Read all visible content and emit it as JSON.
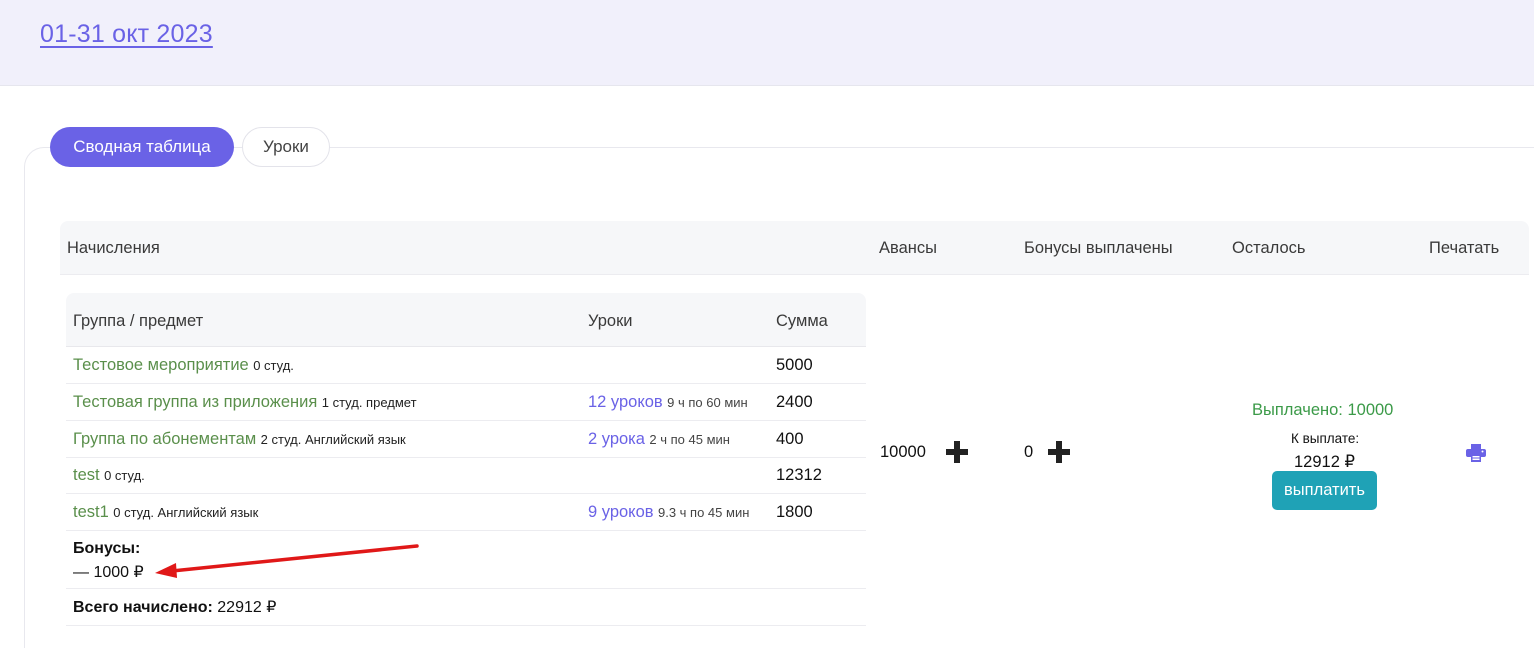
{
  "header": {
    "period": "01-31 окт 2023"
  },
  "tabs": [
    {
      "label": "Сводная таблица",
      "active": true
    },
    {
      "label": "Уроки",
      "active": false
    }
  ],
  "table": {
    "columns": [
      "Начисления",
      "Авансы",
      "Бонусы выплачены",
      "Осталось",
      "Печатать"
    ],
    "accruals": {
      "columns": [
        "Группа / предмет",
        "Уроки",
        "Сумма"
      ],
      "rows": [
        {
          "group": "Тестовое мероприятие",
          "meta": "0 студ.",
          "lessons": "",
          "lessons_meta": "",
          "sum": "5000"
        },
        {
          "group": "Тестовая группа из приложения",
          "meta": "1 студ. предмет",
          "lessons": "12 уроков",
          "lessons_meta": "9 ч по 60 мин",
          "sum": "2400"
        },
        {
          "group": "Группа по абонементам",
          "meta": "2 студ. Английский язык",
          "lessons": "2 урока",
          "lessons_meta": "2 ч по 45 мин",
          "sum": "400"
        },
        {
          "group": "test",
          "meta": "0 студ.",
          "lessons": "",
          "lessons_meta": "",
          "sum": "12312"
        },
        {
          "group": "test1",
          "meta": "0 студ. Английский язык",
          "lessons": "9 уроков",
          "lessons_meta": "9.3 ч по 45 мин",
          "sum": "1800"
        }
      ],
      "bonus_label": "Бонусы:",
      "bonus_value": "— 1000 ₽",
      "total_label": "Всего начислено:",
      "total_value": "22912 ₽"
    },
    "advances": "10000",
    "bonuses_paid": "0",
    "remaining": {
      "paid": "Выплачено: 10000",
      "due_label": "К выплате:",
      "due_value": "12912 ₽",
      "pay_button": "выплатить"
    }
  },
  "colors": {
    "accent": "#6a62e6",
    "group_link": "#5a8f4b",
    "paid": "#3b9a48",
    "pay_button": "#1fa2b6",
    "annotation_arrow": "#e01818"
  }
}
